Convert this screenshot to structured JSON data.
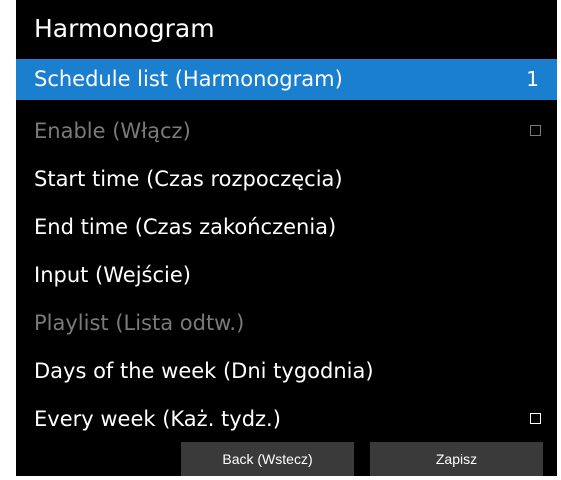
{
  "window": {
    "title": "Harmonogram"
  },
  "menu": {
    "items": [
      {
        "label": "Schedule list (Harmonogram)",
        "value": "1"
      },
      {
        "label": "Enable (Włącz)",
        "checked": false
      },
      {
        "label": "Start time (Czas rozpoczęcia)"
      },
      {
        "label": "End time (Czas zakończenia)"
      },
      {
        "label": "Input (Wejście)"
      },
      {
        "label": "Playlist (Lista odtw.)"
      },
      {
        "label": "Days of the week (Dni tygodnia)"
      },
      {
        "label": "Every week (Każ. tydz.)",
        "checked": false
      }
    ]
  },
  "buttons": {
    "back_label": "Back (Wstecz)",
    "save_label": "Zapisz"
  },
  "colors": {
    "selected_highlight": "#1b7fcf",
    "disabled_text": "#7a7a7a",
    "button_bg": "#3a3a3a",
    "panel_bg": "#000000"
  }
}
